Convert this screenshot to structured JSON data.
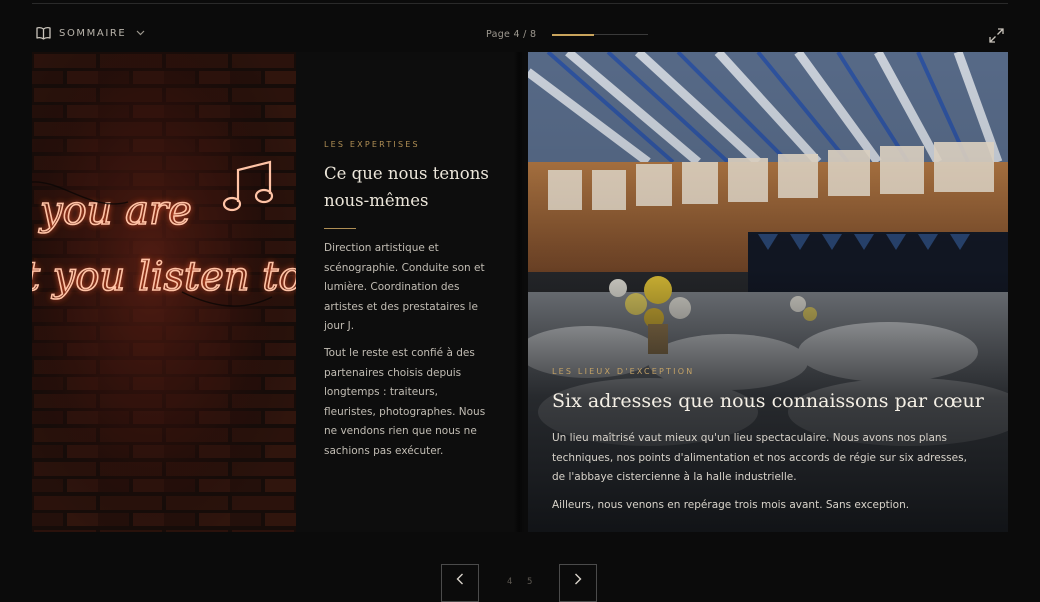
{
  "toolbar": {
    "sommaire_label": "SOMMAIRE",
    "page_indicator": "Page 4 / 8",
    "progress_fraction": 0.43
  },
  "left_page": {
    "eyebrow": "LES EXPERTISES",
    "title": "Ce que nous tenons nous-mêmes",
    "paragraphs": [
      "Direction artistique et scénographie. Conduite son et lumière. Coordination des artistes et des prestataires le jour J.",
      "Tout le reste est confié à des partenaires choisis depuis longtemps : traiteurs, fleuristes, photographes. Nous ne vendons rien que nous ne sachions pas exécuter."
    ],
    "neon_lines": [
      "you are",
      "t you listen to"
    ]
  },
  "right_page": {
    "eyebrow": "LES LIEUX D'EXCEPTION",
    "title": "Six adresses que nous connaissons par cœur",
    "paragraphs": [
      "Un lieu maîtrisé vaut mieux qu'un lieu spectaculaire. Nous avons nos plans techniques, nos points d'alimentation et nos accords de régie sur six adresses, de l'abbaye cistercienne à la halle industrielle.",
      "Ailleurs, nous venons en repérage trois mois avant. Sans exception."
    ]
  },
  "pager": {
    "current": "4",
    "next": "5"
  },
  "colors": {
    "background": "#0b0b0b",
    "accent_gold": "#c9a45c",
    "neon": "#ffb090",
    "text_light": "#ece6da"
  }
}
